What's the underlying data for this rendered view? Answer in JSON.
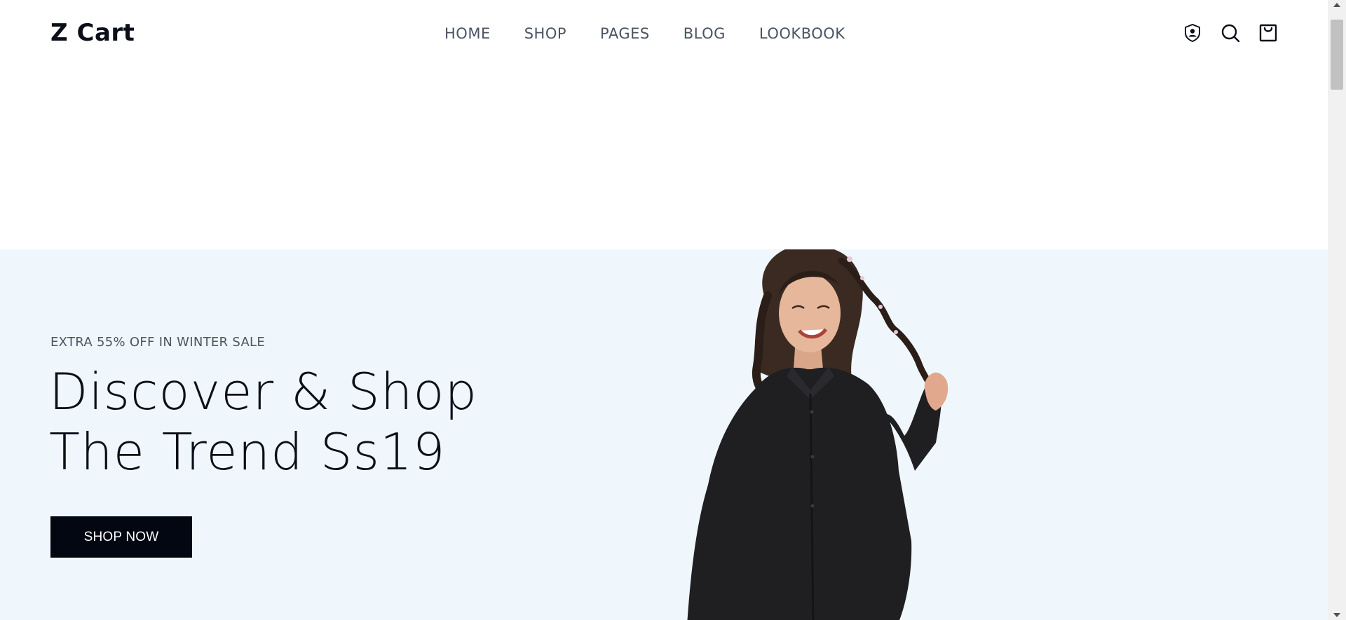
{
  "header": {
    "logo": "Z Cart",
    "nav": [
      {
        "label": "HOME"
      },
      {
        "label": "SHOP"
      },
      {
        "label": "PAGES"
      },
      {
        "label": "BLOG"
      },
      {
        "label": "LOOKBOOK"
      }
    ],
    "icons": [
      "account-shield-icon",
      "search-icon",
      "shopping-bag-icon"
    ]
  },
  "hero": {
    "eyebrow": "EXTRA 55% OFF IN WINTER SALE",
    "headline_line1": "Discover & Shop",
    "headline_line2": "The Trend Ss19",
    "cta_label": "SHOP NOW",
    "background_color": "#f0f7fc"
  },
  "colors": {
    "accent": "#030712",
    "nav_text": "#4b5563",
    "text": "#0b0f19"
  }
}
